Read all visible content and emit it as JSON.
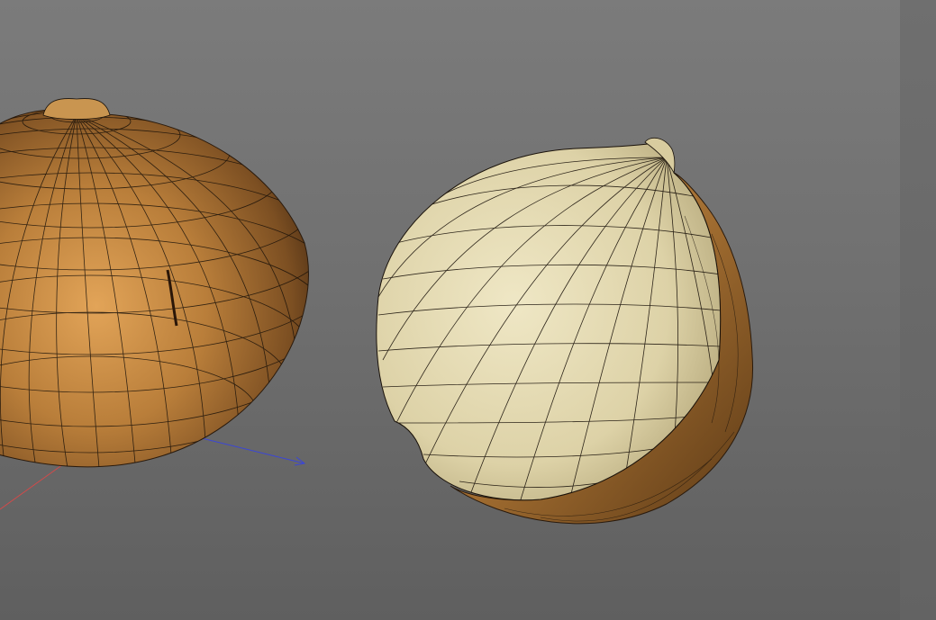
{
  "viewport": {
    "background_top": "#7b7b7b",
    "background_bottom": "#5f5f5f"
  },
  "axes": {
    "x_axis_color": "#d24a4a",
    "z_axis_color": "#3b46d6"
  },
  "objects": {
    "whole_seed": {
      "material": "#b07a3a",
      "wireframe": "#1a120a"
    },
    "cut_seed": {
      "cut_face": "#e4dbb4",
      "skin": "#b07a3a",
      "wireframe": "#1a120a"
    }
  }
}
